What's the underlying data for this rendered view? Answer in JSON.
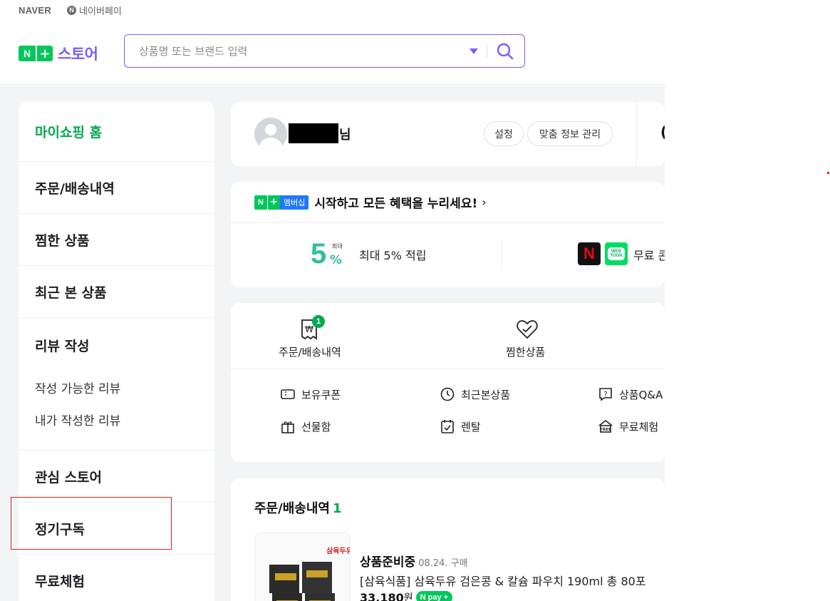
{
  "top": {
    "naver": "NAVER",
    "npay_label": "네이버페이"
  },
  "header": {
    "store_title": "스토어",
    "search_placeholder": "상품명 또는 브랜드 입력"
  },
  "sidebar": {
    "home": "마이쇼핑 홈",
    "orders": "주문/배송내역",
    "wishlist": "찜한 상품",
    "recent": "최근 본 상품",
    "review": "리뷰 작성",
    "review_sub": [
      "작성 가능한 리뷰",
      "내가 작성한 리뷰"
    ],
    "stores": "관심 스토어",
    "subscription": "정기구독",
    "trial": "무료체험"
  },
  "profile": {
    "suffix": "님",
    "settings": "설정",
    "manage": "맞춤 정보 관리"
  },
  "membership": {
    "badge_label": "멤버십",
    "title": "시작하고 모든 혜택을 누리세요!",
    "five": "5",
    "percent": "%",
    "max_small": "최대",
    "benefit1": "최대 5% 적립",
    "benefit2": "무료 콘"
  },
  "menu": {
    "orders_label": "주문/배송내역",
    "orders_badge": "1",
    "wish_label": "찜한상품",
    "items": {
      "coupon": "보유쿠폰",
      "recent": "최근본상품",
      "qna": "상품Q&A",
      "gift": "선물함",
      "rental": "렌탈",
      "trial": "무료체험"
    }
  },
  "orders": {
    "title": "주문/배송내역",
    "count": "1",
    "status": "상품준비중",
    "date": "08.24. 구매",
    "product": "[삼육식품] 삼육두유 검은콩 & 칼슘 파우치 190ml 총 80포",
    "price": "33,180",
    "won": "원",
    "npay_pill": "pay"
  },
  "colors": {
    "green": "#03c75a",
    "purple": "#7b5cff",
    "highlight": "#e02020"
  }
}
